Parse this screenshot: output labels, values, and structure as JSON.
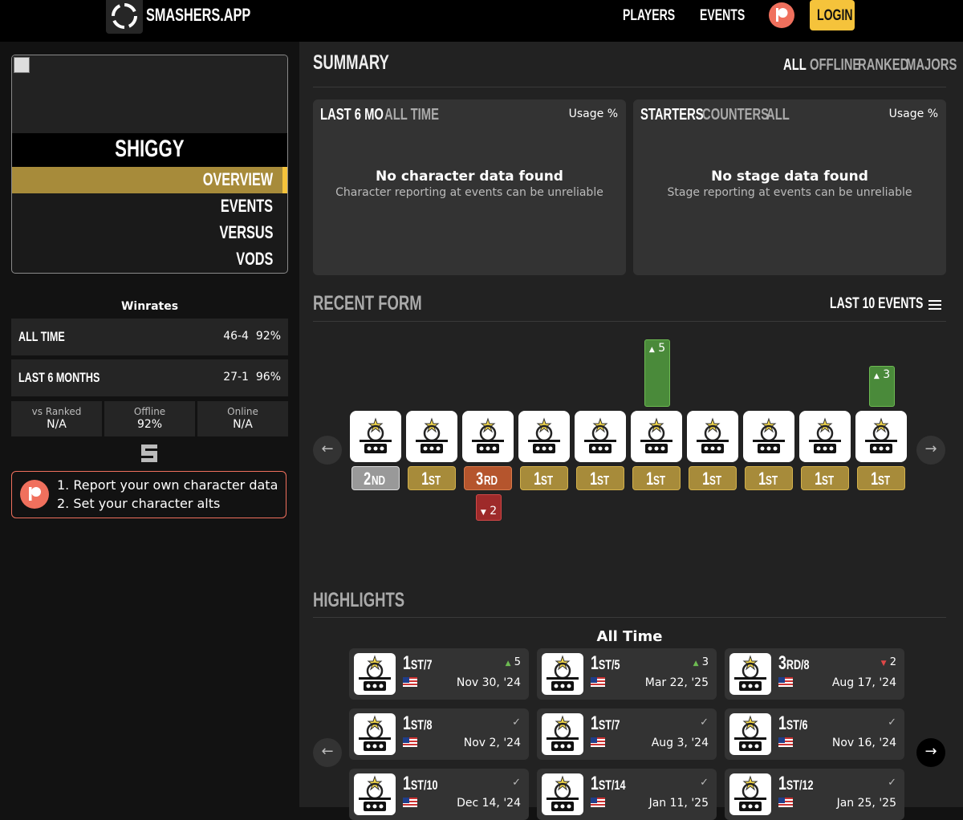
{
  "nav": {
    "logo": "SMASHERS.APP",
    "players": "PLAYERS",
    "events": "EVENTS",
    "login": "LOGIN"
  },
  "profile": {
    "name": "SHIGGY",
    "tabs": [
      "OVERVIEW",
      "EVENTS",
      "VERSUS",
      "VODS"
    ]
  },
  "winrates": {
    "title": "Winrates",
    "all_time": {
      "label": "ALL TIME",
      "record": "46-4",
      "pct": "92%"
    },
    "last6": {
      "label": "LAST 6 MONTHS",
      "record": "27-1",
      "pct": "96%"
    },
    "subs": [
      {
        "label": "vs Ranked",
        "value": "N/A"
      },
      {
        "label": "Offline",
        "value": "92%"
      },
      {
        "label": "Online",
        "value": "N/A"
      }
    ]
  },
  "alert": {
    "line1": "1. Report your own character data",
    "line2": "2. Set your character alts"
  },
  "summary": {
    "title": "SUMMARY",
    "filters": [
      "ALL",
      "OFFLINE",
      "RANKED",
      "MAJORS"
    ],
    "char_panel": {
      "tabs": [
        "LAST 6 MO",
        "ALL TIME"
      ],
      "usage": "Usage %",
      "empty_title": "No character data found",
      "empty_sub": "Character reporting at events can be unreliable"
    },
    "stage_panel": {
      "tabs": [
        "STARTERS",
        "COUNTERS",
        "ALL"
      ],
      "usage": "Usage %",
      "empty_title": "No stage data found",
      "empty_sub": "Stage reporting at events can be unreliable"
    }
  },
  "recent_form": {
    "title": "RECENT FORM",
    "range": "LAST 10 EVENTS",
    "events": [
      {
        "place": "2",
        "suffix": "ND",
        "tier": "p2",
        "delta": null
      },
      {
        "place": "1",
        "suffix": "ST",
        "tier": "p1",
        "delta": null
      },
      {
        "place": "3",
        "suffix": "RD",
        "tier": "p3",
        "delta": "-2"
      },
      {
        "place": "1",
        "suffix": "ST",
        "tier": "p1",
        "delta": null
      },
      {
        "place": "1",
        "suffix": "ST",
        "tier": "p1",
        "delta": null
      },
      {
        "place": "1",
        "suffix": "ST",
        "tier": "p1",
        "delta": "+5"
      },
      {
        "place": "1",
        "suffix": "ST",
        "tier": "p1",
        "delta": null
      },
      {
        "place": "1",
        "suffix": "ST",
        "tier": "p1",
        "delta": null
      },
      {
        "place": "1",
        "suffix": "ST",
        "tier": "p1",
        "delta": null
      },
      {
        "place": "1",
        "suffix": "ST",
        "tier": "p1",
        "delta": "+3"
      }
    ],
    "labels": {
      "up5": "5",
      "up3": "3",
      "down2": "2"
    }
  },
  "highlights": {
    "title": "HIGHLIGHTS",
    "subtitle": "All Time",
    "items": [
      {
        "place": "1",
        "suffix": "ST/7",
        "date": "Nov 30, '24",
        "delta": "5",
        "kind": "up"
      },
      {
        "place": "1",
        "suffix": "ST/5",
        "date": "Mar 22, '25",
        "delta": "3",
        "kind": "up"
      },
      {
        "place": "3",
        "suffix": "RD/8",
        "date": "Aug 17, '24",
        "delta": "2",
        "kind": "down"
      },
      {
        "place": "1",
        "suffix": "ST/8",
        "date": "Nov 2, '24",
        "delta": "✓",
        "kind": "check"
      },
      {
        "place": "1",
        "suffix": "ST/7",
        "date": "Aug 3, '24",
        "delta": "✓",
        "kind": "check"
      },
      {
        "place": "1",
        "suffix": "ST/6",
        "date": "Nov 16, '24",
        "delta": "✓",
        "kind": "check"
      },
      {
        "place": "1",
        "suffix": "ST/10",
        "date": "Dec 14, '24",
        "delta": "✓",
        "kind": "check"
      },
      {
        "place": "1",
        "suffix": "ST/14",
        "date": "Jan 11, '25",
        "delta": "✓",
        "kind": "check"
      },
      {
        "place": "1",
        "suffix": "ST/12",
        "date": "Jan 25, '25",
        "delta": "✓",
        "kind": "check"
      }
    ]
  },
  "colors": {
    "gold": "#f5c33b",
    "patreon": "#f0705d",
    "first": "#a78b3a",
    "up": "#4a8a3a",
    "down": "#9e2a2a"
  },
  "icons": {
    "logo": "ring-logo-icon",
    "patreon": "patreon-icon",
    "menu": "hamburger-icon",
    "prev": "arrow-left-icon",
    "next": "arrow-right-icon",
    "flag": "us-flag-icon",
    "character": "character-stock-icon",
    "smashers": "s-logo-icon"
  }
}
